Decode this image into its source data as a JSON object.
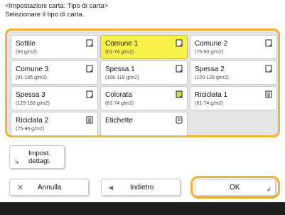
{
  "header": {
    "title": "<Impostazioni carta: Tipo di carta>",
    "instruction": "Selezionare il tipo di carta."
  },
  "paper_types": [
    {
      "name": "Sottile",
      "weight": "(60 g/m2)",
      "icon": "plain-paper-icon",
      "selected": false
    },
    {
      "name": "Comune 1",
      "weight": "(61-74 g/m2)",
      "icon": "plain-paper-icon",
      "selected": true
    },
    {
      "name": "Comune 2",
      "weight": "(75-90 g/m2)",
      "icon": "plain-paper-icon",
      "selected": false
    },
    {
      "name": "Comune 3",
      "weight": "(91-105 g/m2)",
      "icon": "plain-paper-icon",
      "selected": false
    },
    {
      "name": "Spessa 1",
      "weight": "(106-119 g/m2)",
      "icon": "plain-paper-icon",
      "selected": false
    },
    {
      "name": "Spessa 2",
      "weight": "(120-128 g/m2)",
      "icon": "plain-paper-icon",
      "selected": false
    },
    {
      "name": "Spessa 3",
      "weight": "(129-163 g/m2)",
      "icon": "plain-paper-icon",
      "selected": false
    },
    {
      "name": "Colorata",
      "weight": "(61-74 g/m2)",
      "icon": "colored-paper-icon",
      "selected": false
    },
    {
      "name": "Riciclata 1",
      "weight": "(61-74 g/m2)",
      "icon": "recycled-paper-icon",
      "selected": false
    },
    {
      "name": "Riciclata 2",
      "weight": "(75-90 g/m2)",
      "icon": "recycled-paper-icon",
      "selected": false
    },
    {
      "name": "Etichette",
      "weight": "",
      "icon": "label-paper-icon",
      "selected": false
    }
  ],
  "detail_button": {
    "line1": "Impost.",
    "line2": "dettagl."
  },
  "actions": {
    "cancel_label": "Annulla",
    "back_label": "Indietro",
    "ok_label": "OK"
  },
  "colors": {
    "selected": "#f7f24b",
    "focus_border": "#f2b233",
    "footer": "#1f1f1f"
  }
}
